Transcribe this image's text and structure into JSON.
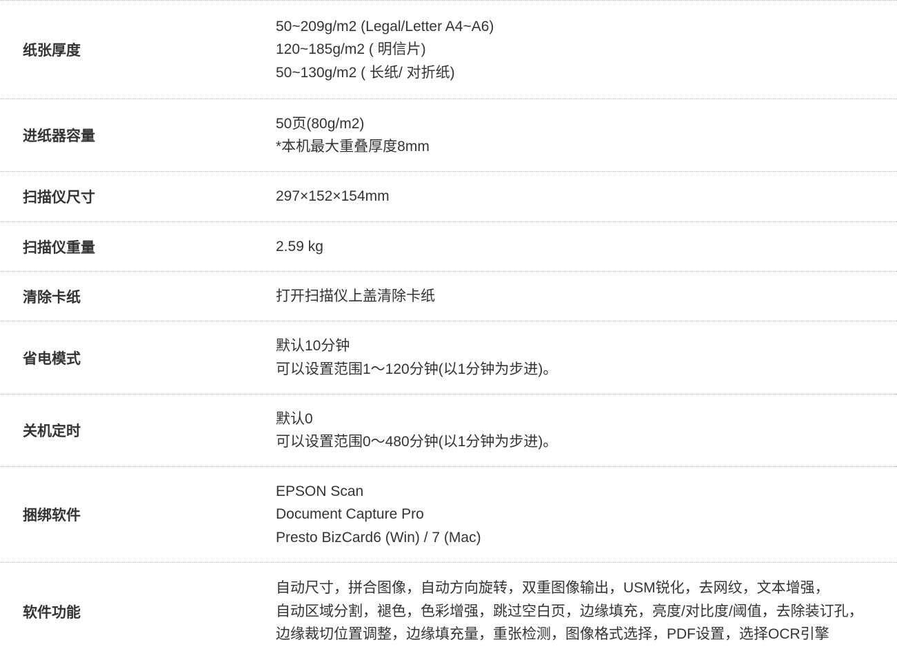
{
  "rows": [
    {
      "label": "纸张厚度",
      "lines": [
        "50~209g/m2 (Legal/Letter A4~A6)",
        "120~185g/m2 ( 明信片)",
        "50~130g/m2 ( 长纸/ 对折纸)"
      ]
    },
    {
      "label": "进纸器容量",
      "lines": [
        "50页(80g/m2)",
        "*本机最大重叠厚度8mm"
      ]
    },
    {
      "label": "扫描仪尺寸",
      "lines": [
        "297×152×154mm"
      ]
    },
    {
      "label": "扫描仪重量",
      "lines": [
        "2.59 kg"
      ]
    },
    {
      "label": "清除卡纸",
      "lines": [
        "打开扫描仪上盖清除卡纸"
      ]
    },
    {
      "label": "省电模式",
      "lines": [
        "默认10分钟",
        "可以设置范围1～120分钟(以1分钟为步进)。"
      ]
    },
    {
      "label": "关机定时",
      "lines": [
        "默认0",
        "可以设置范围0～480分钟(以1分钟为步进)。"
      ]
    },
    {
      "label": "捆绑软件",
      "lines": [
        "EPSON Scan",
        "Document Capture Pro",
        "Presto BizCard6 (Win) / 7 (Mac)"
      ]
    },
    {
      "label": "软件功能",
      "lines": [
        "自动尺寸，拼合图像，自动方向旋转，双重图像输出，USM锐化，去网纹，文本增强，",
        "自动区域分割，褪色，色彩增强，跳过空白页，边缘填充，亮度/对比度/阈值，去除装订孔，",
        "边缘裁切位置调整，边缘填充量，重张检测，图像格式选择，PDF设置，选择OCR引擎"
      ]
    }
  ]
}
